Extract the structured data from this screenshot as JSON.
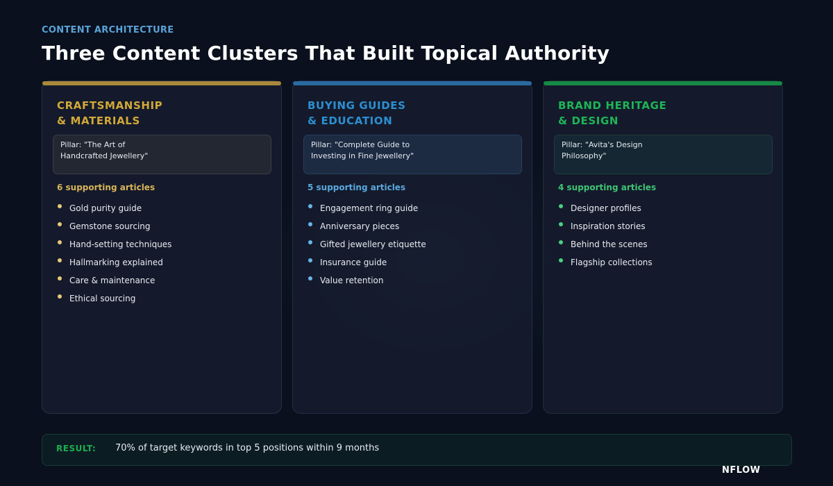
{
  "header": {
    "eyebrow": "CONTENT ARCHITECTURE",
    "title": "Three Content Clusters That Built Topical Authority"
  },
  "clusters": [
    {
      "heading": "CRAFTSMANSHIP\n& MATERIALS",
      "pillar": "Pillar: \"The Art of\nHandcrafted Jewellery\"",
      "count": "6 supporting articles",
      "accent": "#d2a838",
      "items": [
        "Gold purity guide",
        "Gemstone sourcing",
        "Hand-setting techniques",
        "Hallmarking explained",
        "Care & maintenance",
        "Ethical sourcing"
      ]
    },
    {
      "heading": "BUYING GUIDES\n& EDUCATION",
      "pillar": "Pillar: \"Complete Guide to\nInvesting in Fine Jewellery\"",
      "count": "5 supporting articles",
      "accent": "#2c8fd0",
      "items": [
        "Engagement ring guide",
        "Anniversary pieces",
        "Gifted jewellery etiquette",
        "Insurance guide",
        "Value retention"
      ]
    },
    {
      "heading": "BRAND HERITAGE\n& DESIGN",
      "pillar": "Pillar: \"Avita's Design\nPhilosophy\"",
      "count": "4 supporting articles",
      "accent": "#1eb557",
      "items": [
        "Designer profiles",
        "Inspiration stories",
        "Behind the scenes",
        "Flagship collections"
      ]
    }
  ],
  "result": {
    "label": "RESULT:",
    "text": "70% of target keywords in top 5 positions within 9 months"
  },
  "brand": "NFLOW"
}
